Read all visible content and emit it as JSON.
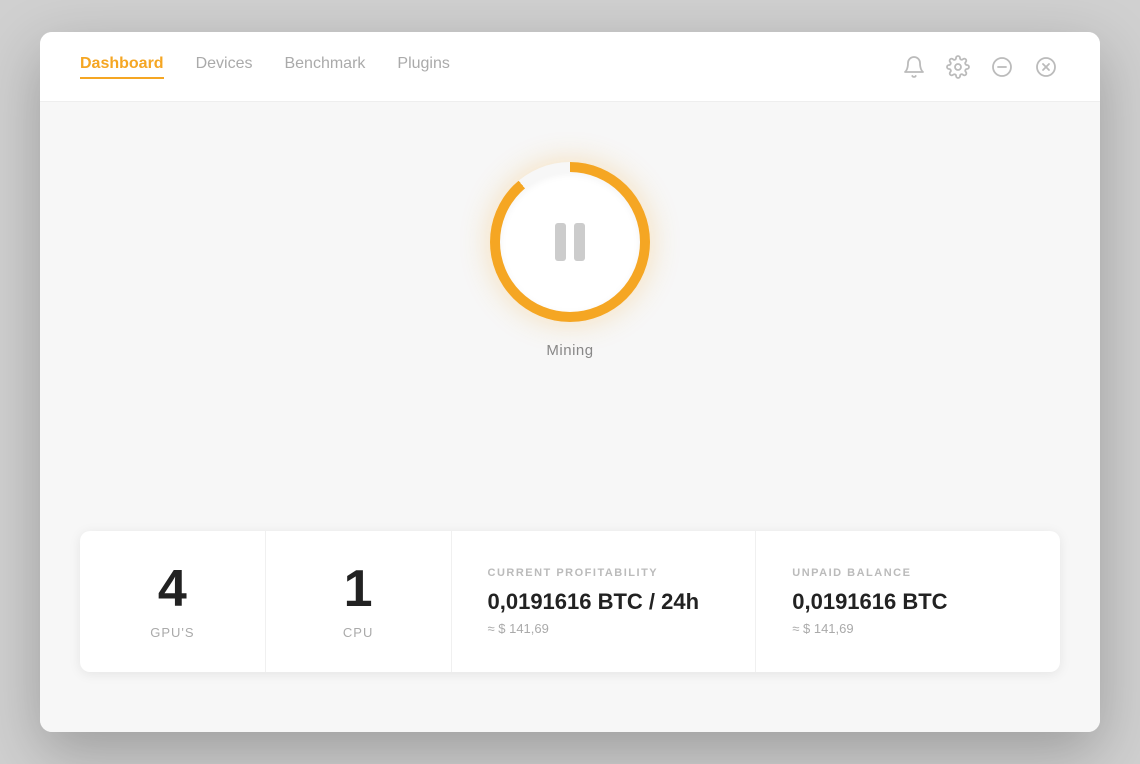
{
  "nav": {
    "items": [
      {
        "id": "dashboard",
        "label": "Dashboard",
        "active": true
      },
      {
        "id": "devices",
        "label": "Devices",
        "active": false
      },
      {
        "id": "benchmark",
        "label": "Benchmark",
        "active": false
      },
      {
        "id": "plugins",
        "label": "Plugins",
        "active": false
      }
    ]
  },
  "header": {
    "icons": [
      {
        "id": "bell",
        "label": "Notifications"
      },
      {
        "id": "gear",
        "label": "Settings"
      },
      {
        "id": "minus",
        "label": "Minimize"
      },
      {
        "id": "close",
        "label": "Close"
      }
    ]
  },
  "mining": {
    "status_label": "Mining"
  },
  "stats": [
    {
      "id": "gpus",
      "value": "4",
      "label": "GPU'S"
    },
    {
      "id": "cpu",
      "value": "1",
      "label": "CPU"
    }
  ],
  "profitability": {
    "label": "CURRENT PROFITABILITY",
    "value": "0,0191616 BTC / 24h",
    "sub": "≈ $ 141,69"
  },
  "balance": {
    "label": "UNPAID BALANCE",
    "value": "0,0191616 BTC",
    "sub": "≈ $ 141,69"
  }
}
